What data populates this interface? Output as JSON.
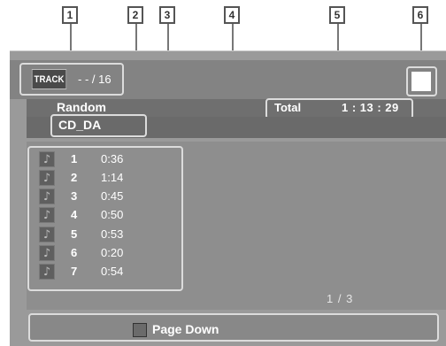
{
  "callouts": [
    "1",
    "2",
    "3",
    "4",
    "5",
    "6"
  ],
  "header": {
    "track_badge": "TRACK",
    "track_count": "- - / 16"
  },
  "info": {
    "mode": "Random",
    "disc_type": "CD_DA",
    "total_label": "Total",
    "total_time": "1 : 13 : 29"
  },
  "tracks": [
    {
      "num": "1",
      "time": "0:36"
    },
    {
      "num": "2",
      "time": "1:14"
    },
    {
      "num": "3",
      "time": "0:45"
    },
    {
      "num": "4",
      "time": "0:50"
    },
    {
      "num": "5",
      "time": "0:53"
    },
    {
      "num": "6",
      "time": "0:20"
    },
    {
      "num": "7",
      "time": "0:54"
    }
  ],
  "page_indicator": "1  /  3",
  "footer": {
    "page_down_label": "Page Down"
  },
  "icons": {
    "track_note": "music-note-icon",
    "page_down_key": "square-button-icon"
  },
  "colors": {
    "screen_bg": "#9a9a9a",
    "header_bg": "#838383",
    "info_bg": "#6f6f6f",
    "highlight_border": "#dcdcdc",
    "text": "#ffffff"
  }
}
